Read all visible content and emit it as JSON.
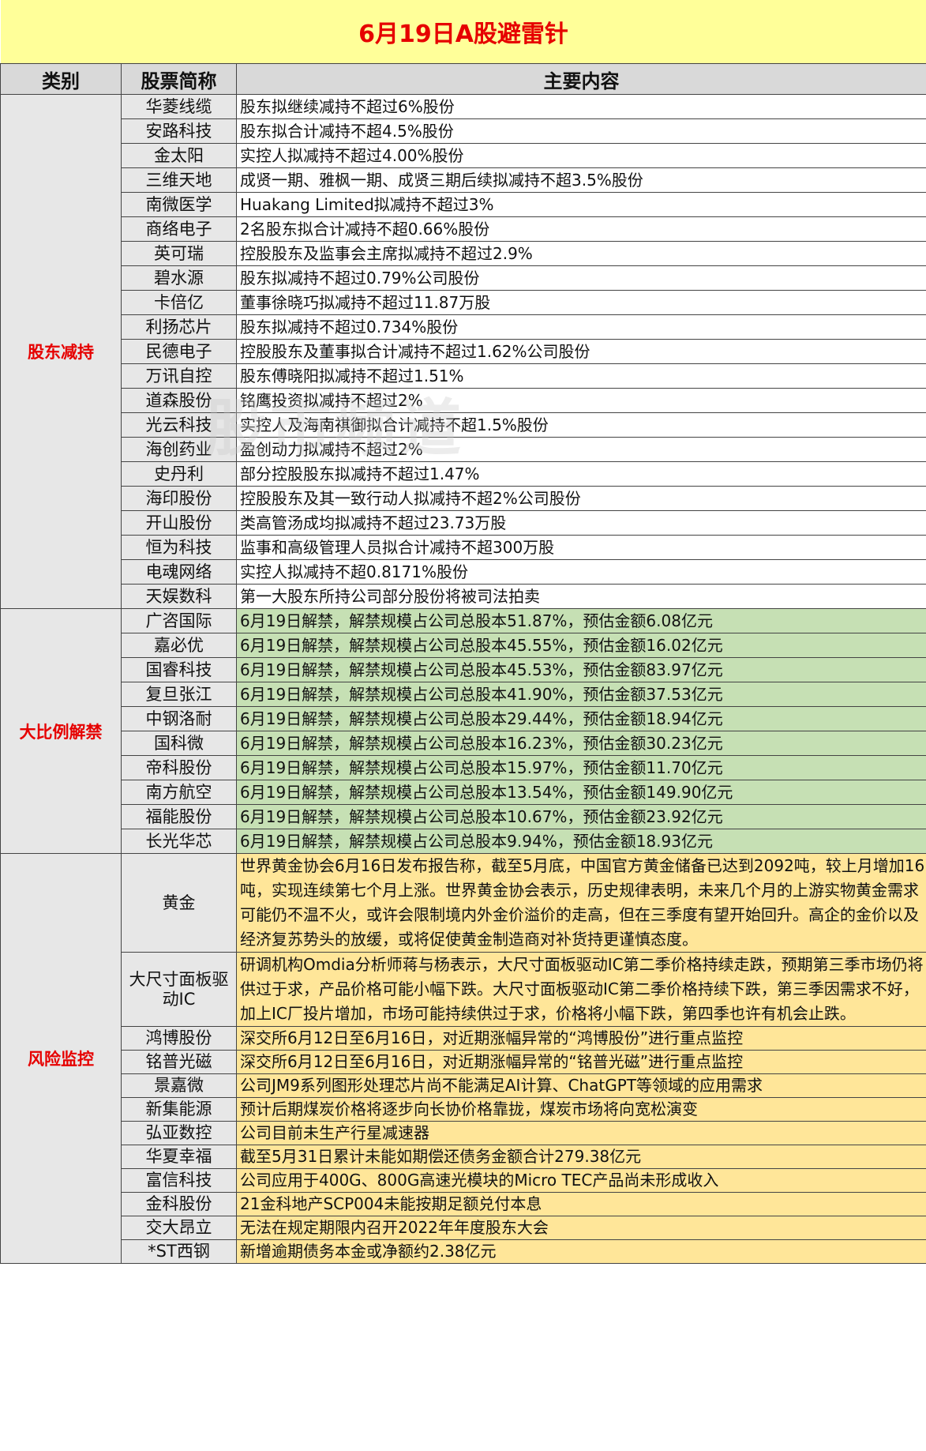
{
  "title": "6月19日A股避雷针",
  "headers": {
    "category": "类别",
    "stock": "股票简称",
    "content": "主要内容"
  },
  "watermark": "股市频道",
  "sections": [
    {
      "category": "股东减持",
      "rows": [
        {
          "stock": "华菱线缆",
          "content": "股东拟继续减持不超过6%股份"
        },
        {
          "stock": "安路科技",
          "content": "股东拟合计减持不超4.5%股份"
        },
        {
          "stock": "金太阳",
          "content": "实控人拟减持不超过4.00%股份"
        },
        {
          "stock": "三维天地",
          "content": "成贤一期、雅枫一期、成贤三期后续拟减持不超3.5%股份"
        },
        {
          "stock": "南微医学",
          "content": "Huakang Limited拟减持不超过3%"
        },
        {
          "stock": "商络电子",
          "content": "2名股东拟合计减持不超0.66%股份"
        },
        {
          "stock": "英可瑞",
          "content": "控股股东及监事会主席拟减持不超过2.9%"
        },
        {
          "stock": "碧水源",
          "content": "股东拟减持不超过0.79%公司股份"
        },
        {
          "stock": "卡倍亿",
          "content": "董事徐晓巧拟减持不超过11.87万股"
        },
        {
          "stock": "利扬芯片",
          "content": "股东拟减持不超过0.734%股份"
        },
        {
          "stock": "民德电子",
          "content": "控股股东及董事拟合计减持不超过1.62%公司股份"
        },
        {
          "stock": "万讯自控",
          "content": "股东傅晓阳拟减持不超过1.51%"
        },
        {
          "stock": "道森股份",
          "content": "铭鹰投资拟减持不超过2%"
        },
        {
          "stock": "光云科技",
          "content": "实控人及海南祺御拟合计减持不超1.5%股份"
        },
        {
          "stock": "海创药业",
          "content": "盈创动力拟减持不超过2%"
        },
        {
          "stock": "史丹利",
          "content": "部分控股股东拟减持不超过1.47%"
        },
        {
          "stock": "海印股份",
          "content": "控股股东及其一致行动人拟减持不超2%公司股份"
        },
        {
          "stock": "开山股份",
          "content": "类高管汤成均拟减持不超过23.73万股"
        },
        {
          "stock": "恒为科技",
          "content": "监事和高级管理人员拟合计减持不超300万股"
        },
        {
          "stock": "电魂网络",
          "content": "实控人拟减持不超0.8171%股份"
        },
        {
          "stock": "天娱数科",
          "content": "第一大股东所持公司部分股份将被司法拍卖"
        }
      ]
    },
    {
      "category": "大比例解禁",
      "rows": [
        {
          "stock": "广咨国际",
          "content": "6月19日解禁，解禁规模占公司总股本51.87%，预估金额6.08亿元"
        },
        {
          "stock": "嘉必优",
          "content": "6月19日解禁，解禁规模占公司总股本45.55%，预估金额16.02亿元"
        },
        {
          "stock": "国睿科技",
          "content": "6月19日解禁，解禁规模占公司总股本45.53%，预估金额83.97亿元"
        },
        {
          "stock": "复旦张江",
          "content": "6月19日解禁，解禁规模占公司总股本41.90%，预估金额37.53亿元"
        },
        {
          "stock": "中钢洛耐",
          "content": "6月19日解禁，解禁规模占公司总股本29.44%，预估金额18.94亿元"
        },
        {
          "stock": "国科微",
          "content": "6月19日解禁，解禁规模占公司总股本16.23%，预估金额30.23亿元"
        },
        {
          "stock": "帝科股份",
          "content": "6月19日解禁，解禁规模占公司总股本15.97%，预估金额11.70亿元"
        },
        {
          "stock": "南方航空",
          "content": "6月19日解禁，解禁规模占公司总股本13.54%，预估金额149.90亿元"
        },
        {
          "stock": "福能股份",
          "content": "6月19日解禁，解禁规模占公司总股本10.67%，预估金额23.92亿元"
        },
        {
          "stock": "长光华芯",
          "content": "6月19日解禁，解禁规模占公司总股本9.94%，预估金额18.93亿元"
        }
      ]
    },
    {
      "category": "风险监控",
      "rows": [
        {
          "stock": "黄金",
          "content": "世界黄金协会6月16日发布报告称，截至5月底，中国官方黄金储备已达到2092吨，较上月增加16吨，实现连续第七个月上涨。世界黄金协会表示，历史规律表明，未来几个月的上游实物黄金需求可能仍不温不火，或许会限制境内外金价溢价的走高，但在三季度有望开始回升。高企的金价以及经济复苏势头的放缓，或将促使黄金制造商对补货持更谨慎态度。",
          "tall": 4
        },
        {
          "stock": "大尺寸面板驱动IC",
          "content": "研调机构Omdia分析师蒋与杨表示，大尺寸面板驱动IC第二季价格持续走跌，预期第三季市场仍将供过于求，产品价格可能小幅下跌。大尺寸面板驱动IC第二季价格持续下跌，第三季因需求不好，加上IC厂投片增加，市场可能持续供过于求，价格将小幅下跌，第四季也许有机会止跌。",
          "tall": 3
        },
        {
          "stock": "鸿博股份",
          "content": "深交所6月12日至6月16日，对近期涨幅异常的“鸿博股份”进行重点监控"
        },
        {
          "stock": "铭普光磁",
          "content": "深交所6月12日至6月16日，对近期涨幅异常的“铭普光磁”进行重点监控"
        },
        {
          "stock": "景嘉微",
          "content": "公司JM9系列图形处理芯片尚不能满足AI计算、ChatGPT等领域的应用需求"
        },
        {
          "stock": "新集能源",
          "content": "预计后期煤炭价格将逐步向长协价格靠拢，煤炭市场将向宽松演变"
        },
        {
          "stock": "弘亚数控",
          "content": "公司目前未生产行星减速器"
        },
        {
          "stock": "华夏幸福",
          "content": "截至5月31日累计未能如期偿还债务金额合计279.38亿元"
        },
        {
          "stock": "富信科技",
          "content": "公司应用于400G、800G高速光模块的Micro TEC产品尚未形成收入"
        },
        {
          "stock": "金科股份",
          "content": "21金科地产SCP004未能按期足额兑付本息"
        },
        {
          "stock": "交大昂立",
          "content": "无法在规定期限内召开2022年年度股东大会"
        },
        {
          "stock": "*ST西钢",
          "content": "新增逾期债务本金或净额约2.38亿元"
        }
      ]
    }
  ]
}
